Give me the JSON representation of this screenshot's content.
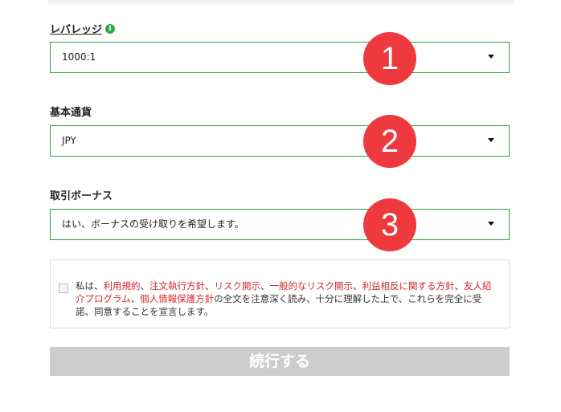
{
  "form": {
    "leverage": {
      "label": "レバレッジ",
      "info_icon": "info-icon",
      "value": "1000:1"
    },
    "base_currency": {
      "label": "基本通貨",
      "value": "JPY"
    },
    "bonus": {
      "label": "取引ボーナス",
      "value": "はい、ボーナスの受け取りを希望します。"
    }
  },
  "badges": [
    "1",
    "2",
    "3"
  ],
  "terms": {
    "prefix": "私は、",
    "links": [
      "利用規約",
      "注文執行方針",
      "リスク開示",
      "一般的なリスク開示",
      "利益相反に関する方針",
      "友人紹介プログラム",
      "個人情報保護方針"
    ],
    "sep": "、",
    "suffix": "の全文を注意深く読み、十分に理解した上で、これらを完全に受諾、同意することを宣言します。"
  },
  "continue_label": "続行する",
  "colors": {
    "accent_green": "#2e9d44",
    "badge_red": "#ee3a3e",
    "link_red": "#d6282b",
    "button_disabled": "#cccccc"
  }
}
